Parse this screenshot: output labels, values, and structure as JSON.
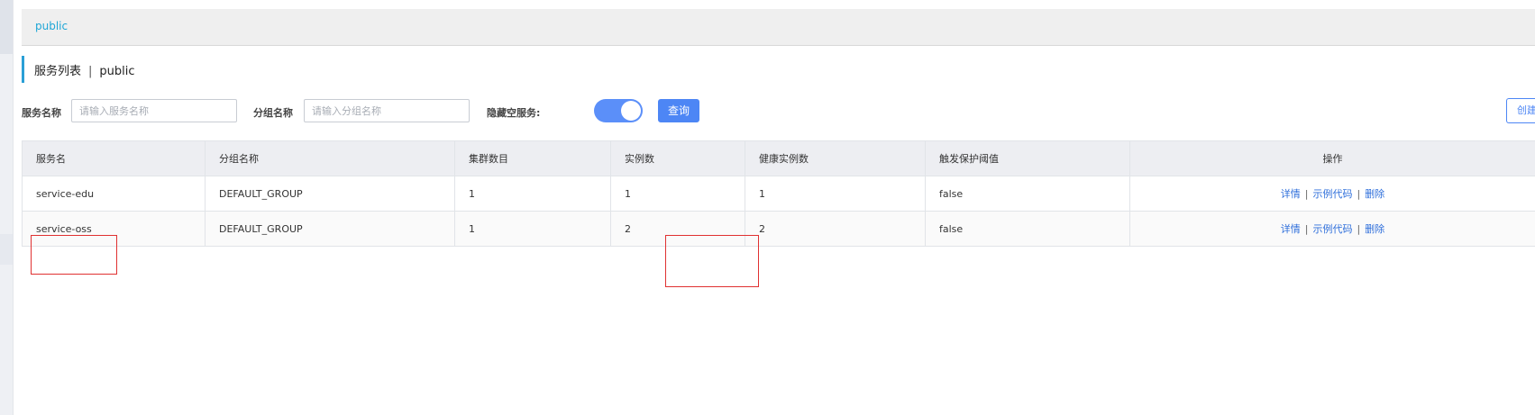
{
  "namespace_bar": {
    "active": "public"
  },
  "header": {
    "title": "服务列表",
    "separator": "|",
    "namespace": "public"
  },
  "filters": {
    "service_name_label": "服务名称",
    "service_name_placeholder": "请输入服务名称",
    "group_name_label": "分组名称",
    "group_name_placeholder": "请输入分组名称",
    "hide_empty_label": "隐藏空服务:",
    "hide_empty_on": true,
    "query_label": "查询",
    "create_label": "创建"
  },
  "table": {
    "columns": [
      "服务名",
      "分组名称",
      "集群数目",
      "实例数",
      "健康实例数",
      "触发保护阈值",
      "操作"
    ],
    "rows": [
      {
        "service": "service-edu",
        "group": "DEFAULT_GROUP",
        "clusters": "1",
        "instances": "1",
        "healthy": "1",
        "protect": "false"
      },
      {
        "service": "service-oss",
        "group": "DEFAULT_GROUP",
        "clusters": "1",
        "instances": "2",
        "healthy": "2",
        "protect": "false"
      }
    ],
    "actions": {
      "detail": "详情",
      "sample_code": "示例代码",
      "delete": "删除",
      "separator": "|"
    }
  },
  "colors": {
    "accent": "#4d86f5",
    "namespace_link": "#1ea6d6",
    "annotation": "#e03131"
  }
}
